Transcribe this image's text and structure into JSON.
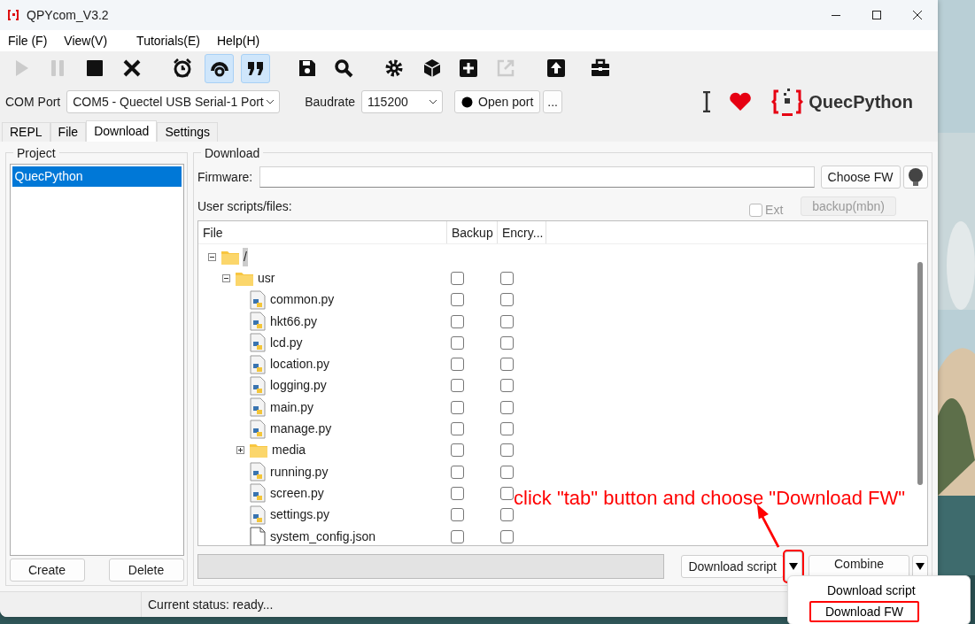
{
  "window": {
    "title": "QPYcom_V3.2"
  },
  "menu": [
    "File (F)",
    "View(V)",
    "Tutorials(E)",
    "Help(H)"
  ],
  "toolbar": [
    {
      "disabled": true,
      "pressed": false
    },
    {
      "disabled": true,
      "pressed": false
    },
    {
      "disabled": false,
      "pressed": false
    },
    {
      "disabled": false,
      "pressed": false
    },
    {
      "disabled": false,
      "pressed": false
    },
    {
      "disabled": false,
      "pressed": true
    },
    {
      "disabled": false,
      "pressed": true
    },
    {
      "disabled": false,
      "pressed": false
    },
    {
      "disabled": false,
      "pressed": false
    },
    {
      "disabled": false,
      "pressed": false
    },
    {
      "disabled": false,
      "pressed": false
    },
    {
      "disabled": false,
      "pressed": false
    },
    {
      "disabled": true,
      "pressed": false
    },
    {
      "disabled": false,
      "pressed": false
    },
    {
      "disabled": false,
      "pressed": false
    }
  ],
  "connection": {
    "com_label": "COM Port",
    "com_value": "COM5 - Quectel USB Serial-1 Port",
    "baud_label": "Baudrate",
    "baud_value": "115200",
    "open_button": "Open port",
    "more_button": "..."
  },
  "brand": {
    "name": "QuecPython"
  },
  "tabs": [
    {
      "label": "REPL",
      "selected": false
    },
    {
      "label": "File",
      "selected": false
    },
    {
      "label": "Download",
      "selected": true
    },
    {
      "label": "Settings",
      "selected": false
    }
  ],
  "project": {
    "title": "Project",
    "items": [
      {
        "label": "QuecPython",
        "selected": true
      }
    ],
    "buttons": [
      "Create",
      "Delete"
    ]
  },
  "download": {
    "title": "Download",
    "firmware_label": "Firmware:",
    "choose_button": "Choose FW",
    "scripts_label": "User scripts/files:",
    "ext": {
      "label": "Ext",
      "checked": false
    },
    "backup_button": {
      "label": "backup(mbn)",
      "disabled": true
    },
    "columns": [
      "File",
      "Backup",
      "Encry..."
    ],
    "tree": [
      {
        "kind": "folder",
        "name": "/",
        "selected": true,
        "expanded": true,
        "children": [
          {
            "kind": "folder",
            "name": "usr",
            "selected": false,
            "expanded": true,
            "backup": false,
            "encrypt": false,
            "children": [
              {
                "kind": "python",
                "name": "common.py",
                "selected": false,
                "backup": false,
                "encrypt": false
              },
              {
                "kind": "python",
                "name": "hkt66.py",
                "selected": false,
                "backup": false,
                "encrypt": false
              },
              {
                "kind": "python",
                "name": "lcd.py",
                "selected": false,
                "backup": false,
                "encrypt": false
              },
              {
                "kind": "python",
                "name": "location.py",
                "selected": false,
                "backup": false,
                "encrypt": false
              },
              {
                "kind": "python",
                "name": "logging.py",
                "selected": false,
                "backup": false,
                "encrypt": false
              },
              {
                "kind": "python",
                "name": "main.py",
                "selected": false,
                "backup": false,
                "encrypt": false
              },
              {
                "kind": "python",
                "name": "manage.py",
                "selected": false,
                "backup": false,
                "encrypt": false
              },
              {
                "kind": "folder",
                "name": "media",
                "selected": false,
                "expanded": false,
                "backup": false,
                "encrypt": false
              },
              {
                "kind": "python",
                "name": "running.py",
                "selected": false,
                "backup": false,
                "encrypt": false
              },
              {
                "kind": "python",
                "name": "screen.py",
                "selected": false,
                "backup": false,
                "encrypt": false
              },
              {
                "kind": "python",
                "name": "settings.py",
                "selected": false,
                "backup": false,
                "encrypt": false
              },
              {
                "kind": "file",
                "name": "system_config.json",
                "selected": false,
                "backup": false,
                "encrypt": false
              }
            ]
          }
        ]
      }
    ],
    "progress": {
      "level": 0
    },
    "download_button": "Download script",
    "combine_button": "Combine"
  },
  "dropdown": [
    {
      "label": "Download script",
      "selected": false
    },
    {
      "label": "Download FW",
      "selected": true
    }
  ],
  "annotation": {
    "text": "click \"tab\" button and choose \"Download FW\""
  },
  "status_bar": {
    "text": "Current status: ready..."
  }
}
